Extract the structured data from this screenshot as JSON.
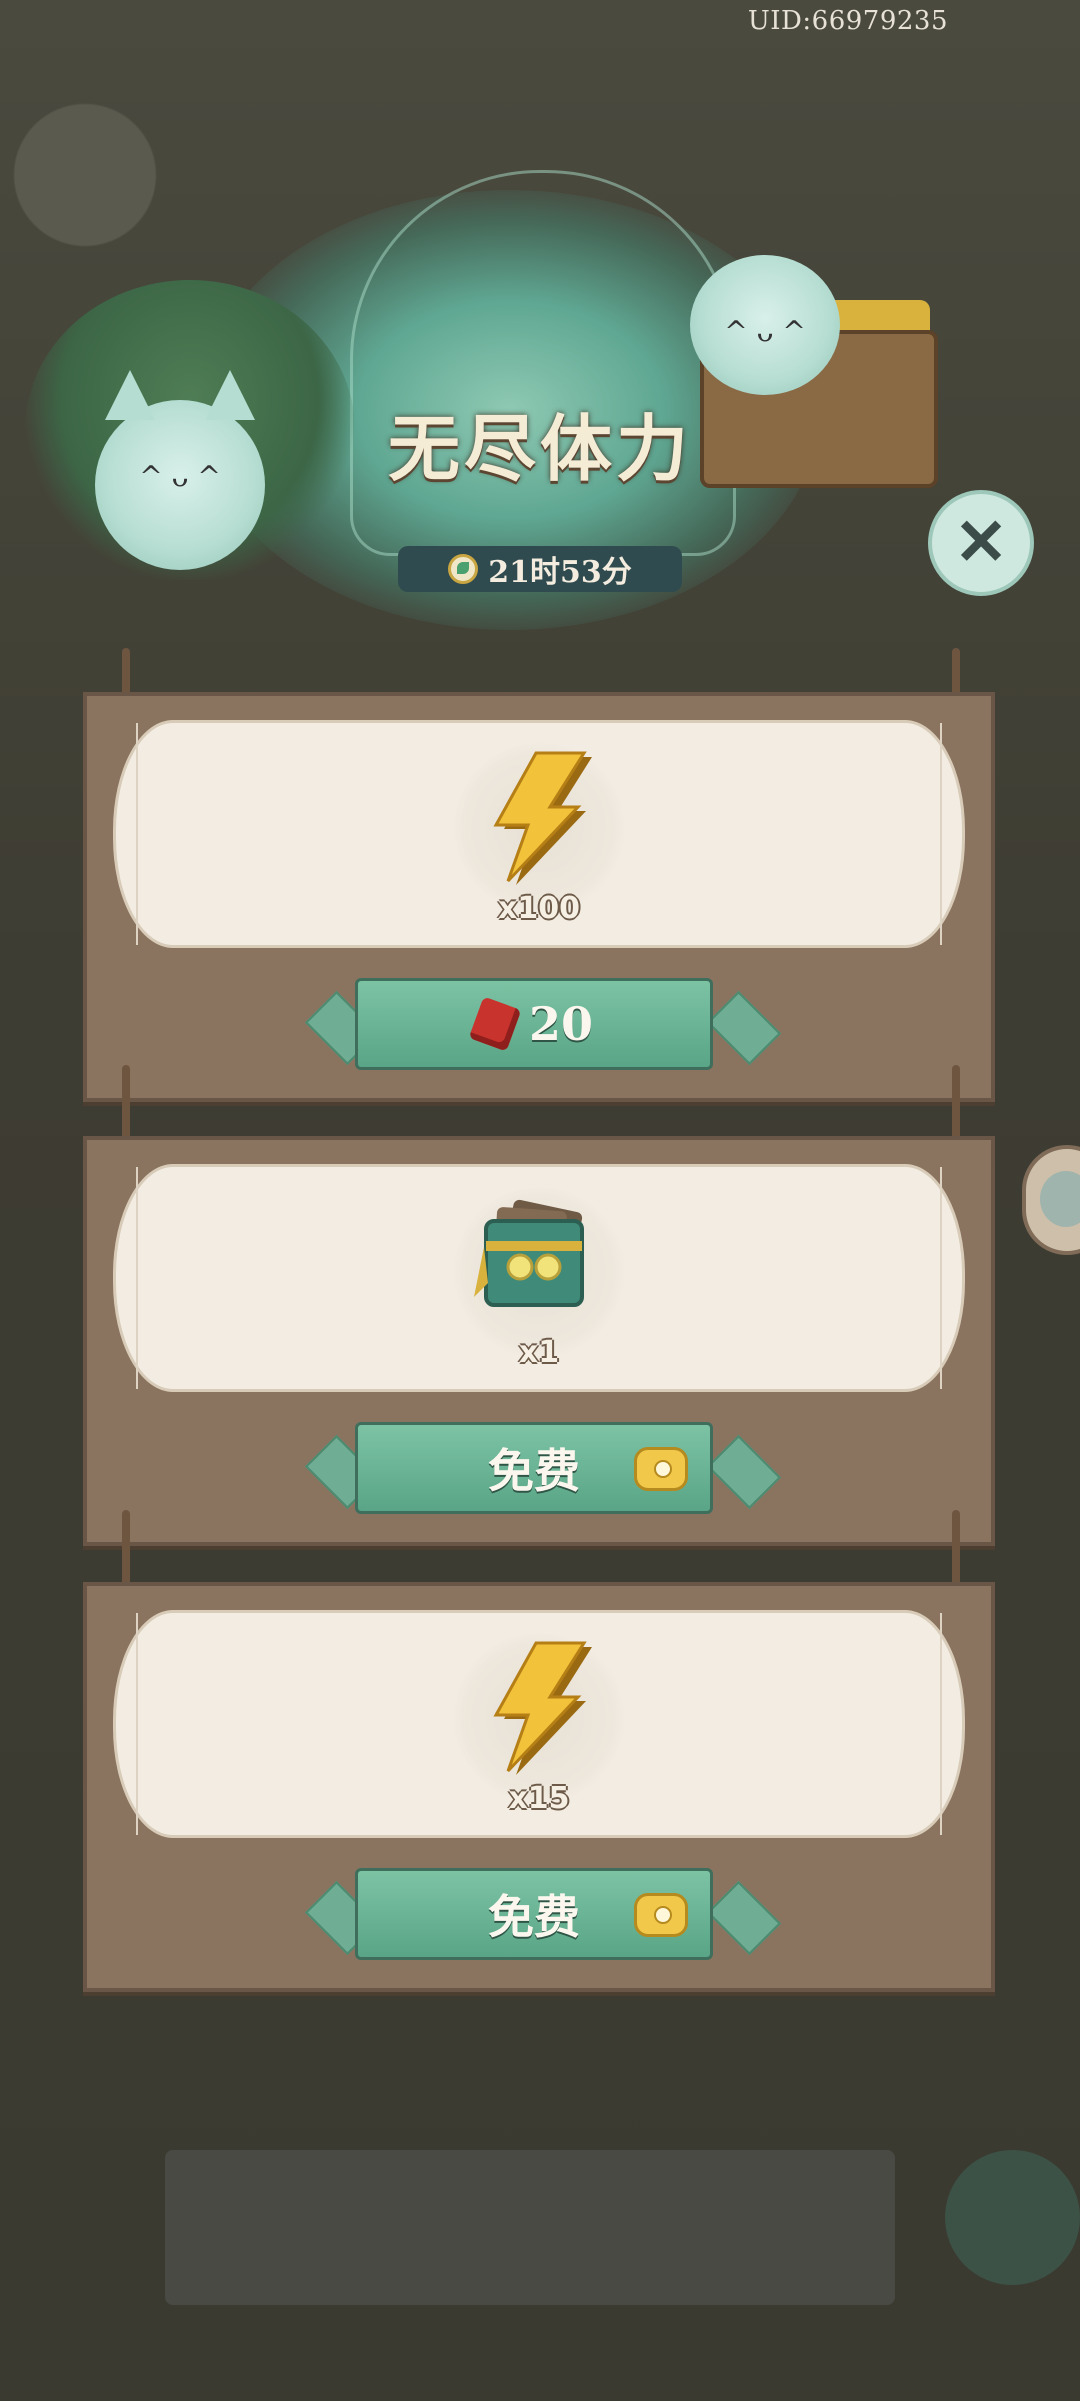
{
  "uid": "UID:66979235",
  "header": {
    "title": "无尽体力",
    "timer": "21时53分",
    "close_icon": "close-icon",
    "timer_icon": "leaf-clock-icon"
  },
  "offers": [
    {
      "item_icon": "lightning-bolt-icon",
      "quantity": "x100",
      "button": {
        "label": "20",
        "icon": "red-gem-icon",
        "type": "paid"
      }
    },
    {
      "item_icon": "ticket-bundle-icon",
      "quantity": "x1",
      "button": {
        "label": "免费",
        "icon": "piggy-bank-icon",
        "type": "free"
      }
    },
    {
      "item_icon": "lightning-bolt-icon",
      "quantity": "x15",
      "button": {
        "label": "免费",
        "icon": "piggy-bank-icon",
        "type": "free"
      }
    }
  ],
  "colors": {
    "button_green": "#6bb696",
    "board_brown": "#8a7460",
    "card_cream": "#f2ece2",
    "title_text": "#f5ecd6"
  }
}
